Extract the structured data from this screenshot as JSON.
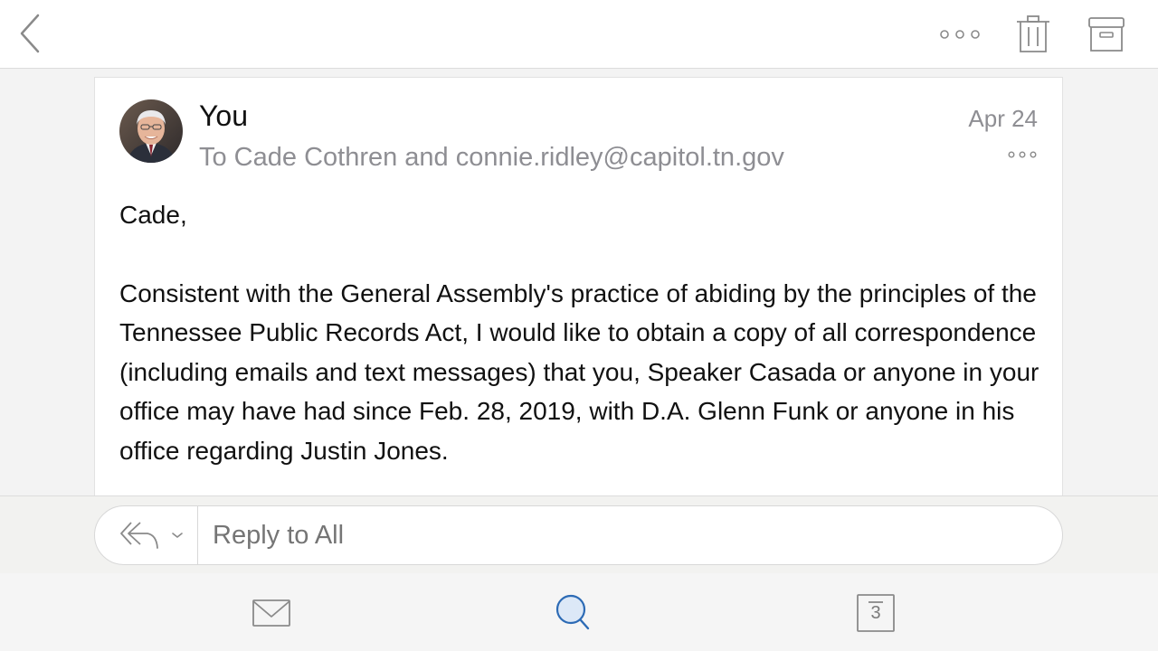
{
  "toolbar": {
    "back": "back-icon",
    "more": "more-horizontal-icon",
    "delete": "trash-icon",
    "archive": "archive-icon"
  },
  "message": {
    "sender": "You",
    "recipients": "To Cade Cothren and connie.ridley@capitol.tn.gov",
    "date": "Apr 24",
    "greeting": "Cade,",
    "body": "Consistent with the General Assembly's practice of abiding by the principles of the Tennessee Public Records Act, I would like to obtain a copy of all correspondence (including emails and text messages) that you, Speaker Casada or anyone in your office may have had since Feb. 28, 2019, with D.A. Glenn Funk or anyone in his office regarding Justin Jones."
  },
  "reply": {
    "placeholder": "Reply to All"
  },
  "tabs": {
    "mail": "mail-icon",
    "search": "search-icon",
    "calendar_day": "3"
  },
  "colors": {
    "accent": "#2d6bb5",
    "secondary_text": "#8e8e93",
    "icon_gray": "#8a8a8a"
  }
}
